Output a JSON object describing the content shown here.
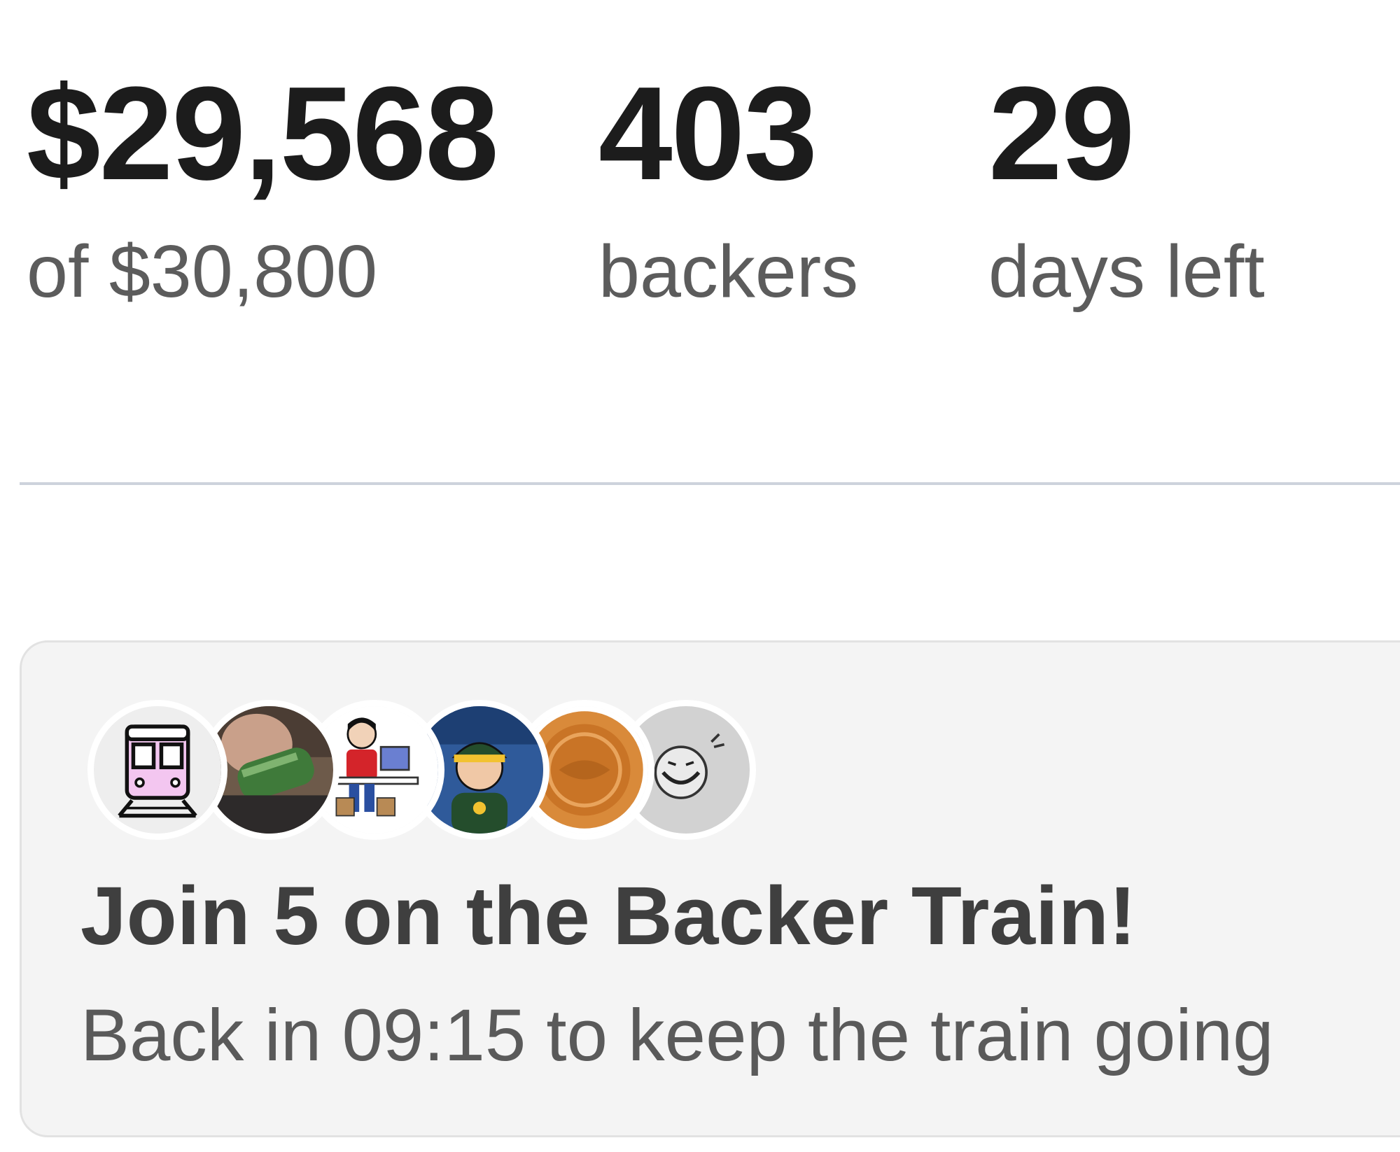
{
  "stats": {
    "pledged": {
      "value": "$29,568",
      "label": "of $30,800"
    },
    "backers": {
      "value": "403",
      "label": "backers"
    },
    "days": {
      "value": "29",
      "label": "days left"
    }
  },
  "backer_train": {
    "title": "Join 5 on the Backer Train!",
    "subtitle": "Back in 09:15 to keep the train going",
    "avatars": [
      {
        "name": "train-icon"
      },
      {
        "name": "backer-photo"
      },
      {
        "name": "cartoon-person-laptop"
      },
      {
        "name": "cartoon-person-cap"
      },
      {
        "name": "coin-photo"
      },
      {
        "name": "sketch-face"
      }
    ]
  },
  "colors": {
    "value_text": "#1c1c1c",
    "label_text": "#5c5c5c",
    "card_bg": "#f4f4f4",
    "divider": "#cdd3dc"
  }
}
